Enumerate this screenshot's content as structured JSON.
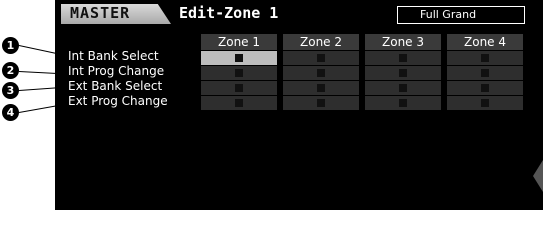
{
  "header": {
    "mode": "MASTER",
    "page_title": "Edit-Zone 1",
    "voice_name": "Full Grand"
  },
  "table": {
    "columns": [
      "Zone 1",
      "Zone 2",
      "Zone 3",
      "Zone 4"
    ],
    "rows": [
      {
        "label": "Int Bank Select",
        "states": [
          true,
          false,
          false,
          false
        ]
      },
      {
        "label": "Int Prog Change",
        "states": [
          false,
          false,
          false,
          false
        ]
      },
      {
        "label": "Ext Bank Select",
        "states": [
          false,
          false,
          false,
          false
        ]
      },
      {
        "label": "Ext Prog Change",
        "states": [
          false,
          false,
          false,
          false
        ]
      }
    ],
    "selected_cell": {
      "row": 0,
      "col": 0
    }
  },
  "callouts": [
    "1",
    "2",
    "3",
    "4"
  ],
  "colors": {
    "screen_bg": "#000000",
    "header_cell": "#3a3a3a",
    "cell": "#2e2e2e",
    "selected_cell": "#bdbdbd"
  }
}
